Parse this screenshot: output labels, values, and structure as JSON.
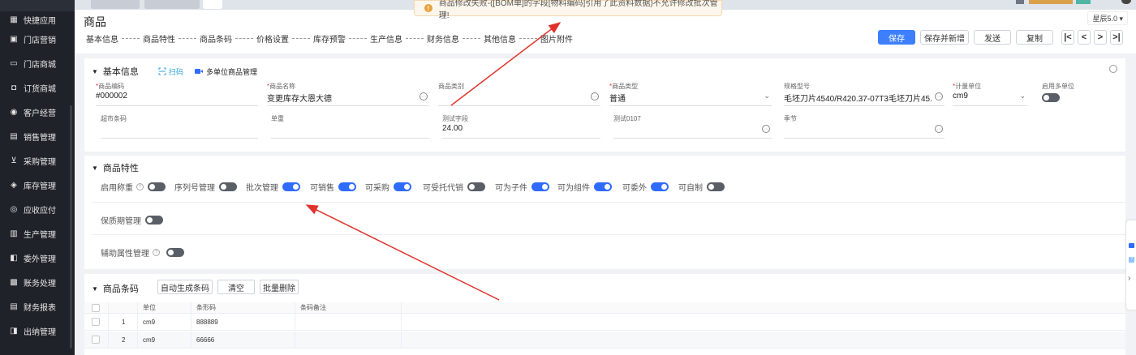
{
  "sidebar": {
    "items": [
      {
        "label": "快捷应用",
        "icon": "grid-icon"
      },
      {
        "label": "门店营销",
        "icon": "store-tag-icon"
      },
      {
        "label": "门店商城",
        "icon": "shop-icon"
      },
      {
        "label": "订货商城",
        "icon": "bag-icon"
      },
      {
        "label": "客户经营",
        "icon": "users-icon"
      },
      {
        "label": "销售管理",
        "icon": "sales-icon"
      },
      {
        "label": "采购管理",
        "icon": "cart-icon"
      },
      {
        "label": "库存管理",
        "icon": "box-icon"
      },
      {
        "label": "应收应付",
        "icon": "money-icon"
      },
      {
        "label": "生产管理",
        "icon": "factory-icon"
      },
      {
        "label": "委外管理",
        "icon": "outsource-icon"
      },
      {
        "label": "账务处理",
        "icon": "ledger-icon"
      },
      {
        "label": "财务报表",
        "icon": "report-icon"
      },
      {
        "label": "出纳管理",
        "icon": "cashier-icon"
      }
    ]
  },
  "toast": {
    "message": "商品修改失败-([BOM单]的字段[物料编码]引用了此资料数据)不允许修改批次管理!"
  },
  "header": {
    "title": "商品",
    "version": "星辰5.0",
    "nav": [
      "基本信息",
      "商品特性",
      "商品条码",
      "价格设置",
      "库存预警",
      "生产信息",
      "财务信息",
      "其他信息",
      "图片附件"
    ],
    "buttons": {
      "save": "保存",
      "save_new": "保存并新增",
      "send": "发送",
      "copy": "复制"
    },
    "pager": {
      "first": "|<",
      "prev": "<",
      "next": ">",
      "last": ">|"
    }
  },
  "basic": {
    "title": "基本信息",
    "scan": "扫码",
    "multi_unit": "多单位商品管理",
    "fields": {
      "code": {
        "label": "商品编码",
        "value": "#000002",
        "required": true
      },
      "name": {
        "label": "商品名称",
        "value": "变更库存大恩大德",
        "required": true
      },
      "category": {
        "label": "商品类别",
        "value": ""
      },
      "type": {
        "label": "商品类型",
        "value": "普通",
        "required": true
      },
      "spec": {
        "label": "规格型号",
        "value": "毛坯刀片4540/R420.37-07T3毛坯刀片45..."
      },
      "unit": {
        "label": "计量单位",
        "value": "cm9",
        "required": true
      },
      "multi": {
        "label": "启用多单位",
        "enabled": false
      },
      "barcode": {
        "label": "超市条码",
        "value": ""
      },
      "weight": {
        "label": "单重",
        "value": ""
      },
      "test": {
        "label": "测试字段",
        "value": "24.00"
      },
      "test0107": {
        "label": "测试0107",
        "value": ""
      },
      "season": {
        "label": "季节",
        "value": ""
      }
    }
  },
  "traits": {
    "title": "商品特性",
    "items": [
      {
        "label": "启用称重",
        "on": false,
        "help": true
      },
      {
        "label": "序列号管理",
        "on": false
      },
      {
        "label": "批次管理",
        "on": true
      },
      {
        "label": "可销售",
        "on": true
      },
      {
        "label": "可采购",
        "on": true
      },
      {
        "label": "可受托代销",
        "on": false
      },
      {
        "label": "可为子件",
        "on": true
      },
      {
        "label": "可为组件",
        "on": true
      },
      {
        "label": "可委外",
        "on": true
      },
      {
        "label": "可自制",
        "on": false
      }
    ],
    "shelf_life": {
      "label": "保质期管理",
      "on": false
    },
    "aux_attr": {
      "label": "辅助属性管理",
      "on": false
    }
  },
  "barcodes": {
    "title": "商品条码",
    "buttons": {
      "auto": "自动生成条码",
      "clear": "清空",
      "batch_delete": "批量删除"
    },
    "columns": [
      "单位",
      "条形码",
      "条码备注"
    ],
    "rows": [
      {
        "no": "1",
        "unit": "cm9",
        "barcode": "888889",
        "remark": ""
      },
      {
        "no": "2",
        "unit": "cm9",
        "barcode": "66666",
        "remark": ""
      }
    ]
  },
  "colors": {
    "primary": "#3d7fff",
    "sidebar_bg": "#1f2329",
    "annotation": "#e0322b",
    "toggle_on": "#2f6bff"
  }
}
